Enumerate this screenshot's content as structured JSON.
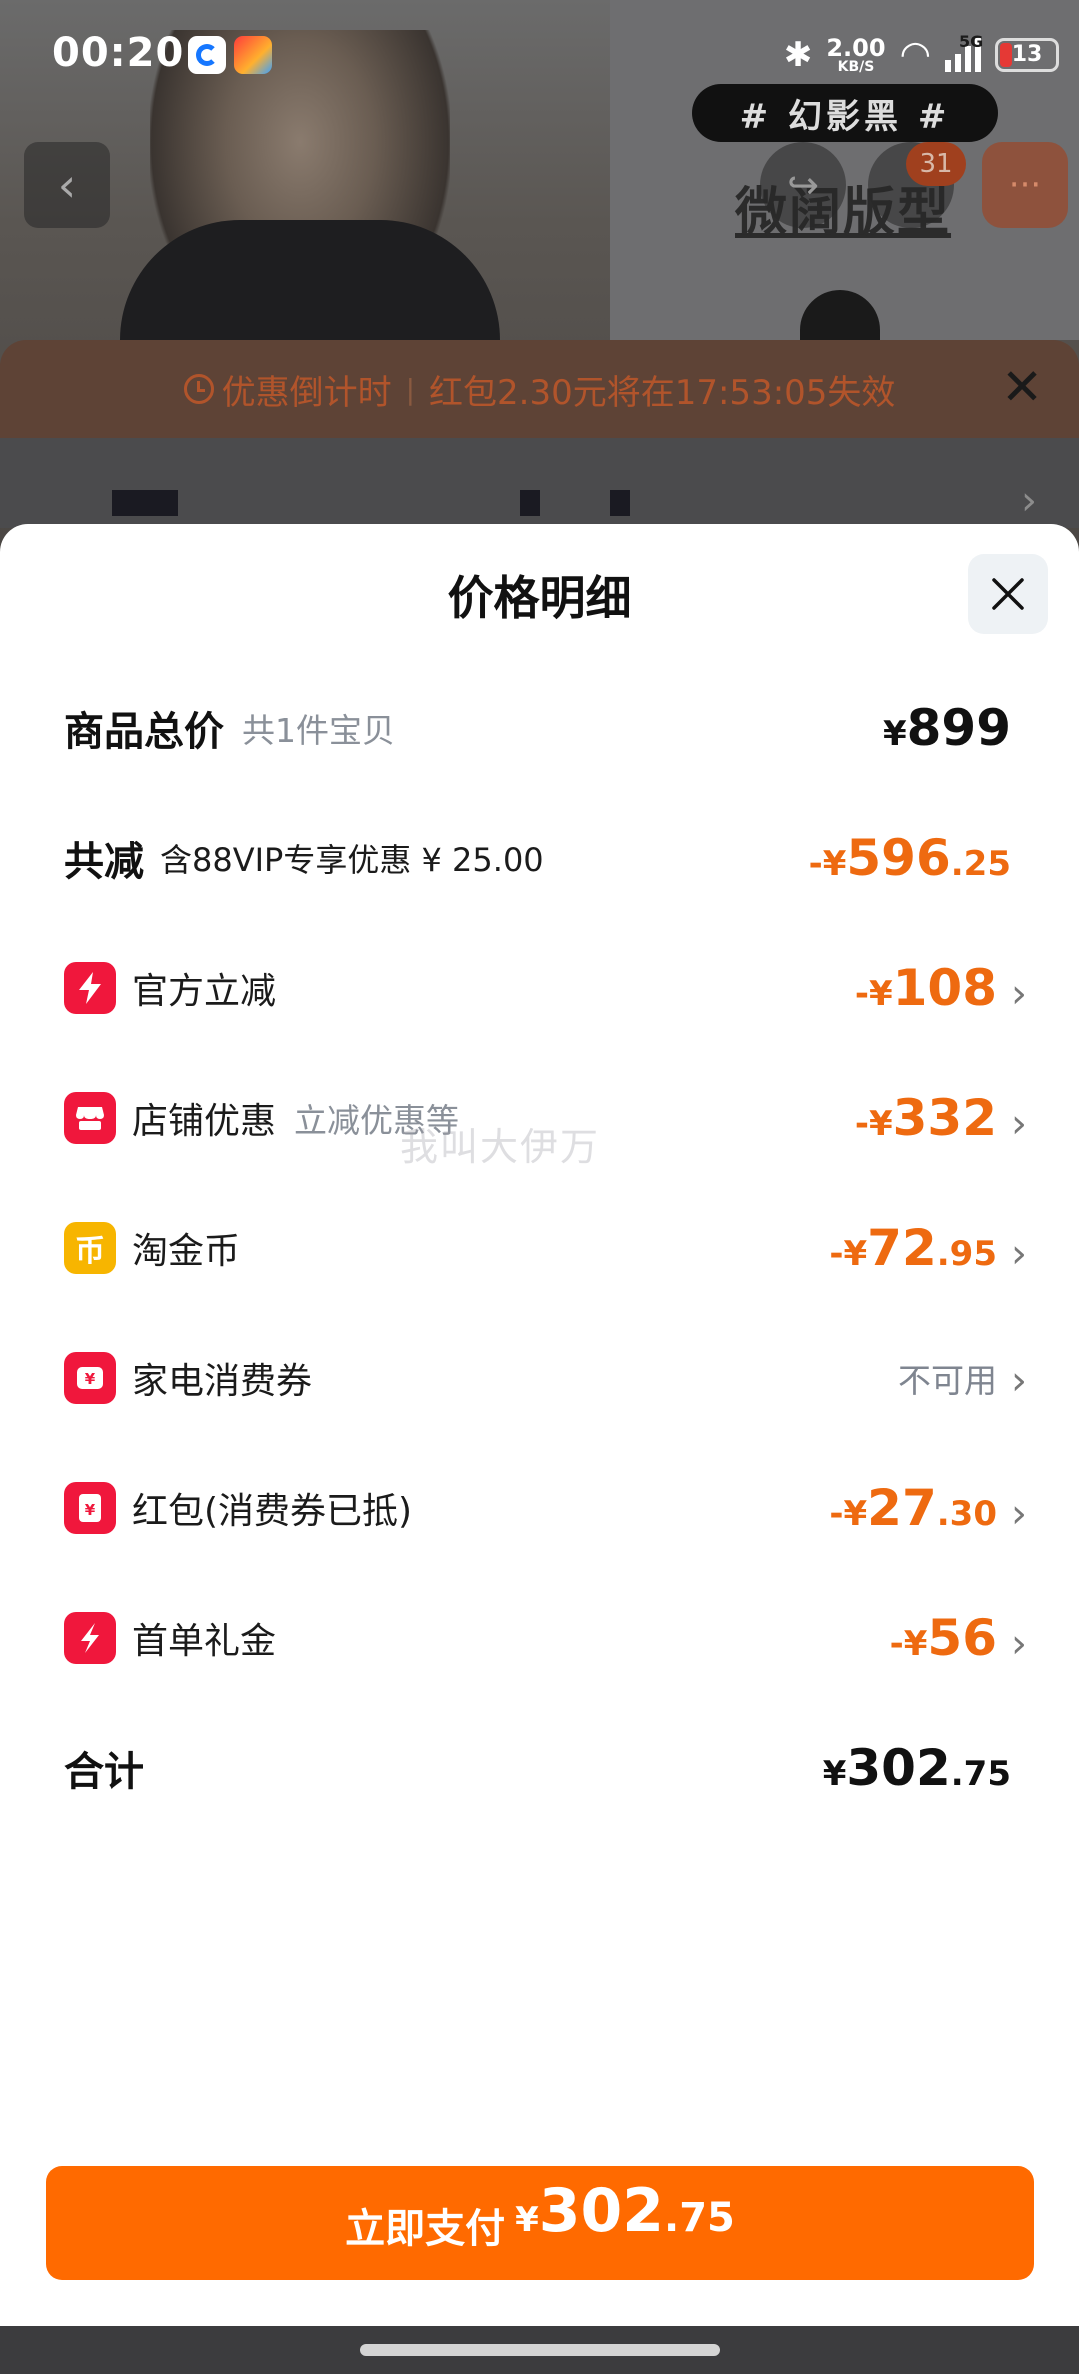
{
  "status_bar": {
    "time": "00:20",
    "net_speed_value": "2.00",
    "net_speed_unit": "KB/S",
    "network": "5G",
    "battery": "13"
  },
  "background": {
    "hashtag": "# 幻影黑 #",
    "slogan": "微阔版型",
    "cart_count": "31"
  },
  "countdown": {
    "label": "优惠倒计时",
    "message": "红包2.30元将在17:53:05失效"
  },
  "sheet": {
    "title": "价格明细",
    "total": {
      "label": "商品总价",
      "note": "共1件宝贝",
      "currency": "¥",
      "amount": "899"
    },
    "discount": {
      "label": "共减",
      "note": "含88VIP专享优惠 ¥ 25.00",
      "prefix": "-¥",
      "amount": "596",
      "decimals": ".25"
    },
    "items": [
      {
        "icon": "lightning-icon",
        "label": "官方立减",
        "note": "",
        "prefix": "-¥",
        "amount": "108",
        "decimals": ""
      },
      {
        "icon": "shop-icon",
        "label": "店铺优惠",
        "note": "立减优惠等",
        "prefix": "-¥",
        "amount": "332",
        "decimals": ""
      },
      {
        "icon": "coin-icon",
        "label": "淘金币",
        "note": "",
        "prefix": "-¥",
        "amount": "72",
        "decimals": ".95"
      },
      {
        "icon": "coupon-icon",
        "label": "家电消费券",
        "note": "",
        "status": "不可用"
      },
      {
        "icon": "redpacket-icon",
        "label": "红包(消费券已抵)",
        "note": "",
        "prefix": "-¥",
        "amount": "27",
        "decimals": ".30"
      },
      {
        "icon": "gift-icon",
        "label": "首单礼金",
        "note": "",
        "prefix": "-¥",
        "amount": "56",
        "decimals": ""
      }
    ],
    "sum": {
      "label": "合计",
      "currency": "¥",
      "amount": "302",
      "decimals": ".75"
    },
    "watermark": "我叫大伊万"
  },
  "pay_button": {
    "label": "立即支付",
    "currency": "¥",
    "amount": "302",
    "decimals": ".75"
  },
  "colors": {
    "accent": "#ff6a00",
    "discount": "#ee6a10",
    "icon_red": "#f0173c",
    "icon_gold": "#f7b500"
  }
}
